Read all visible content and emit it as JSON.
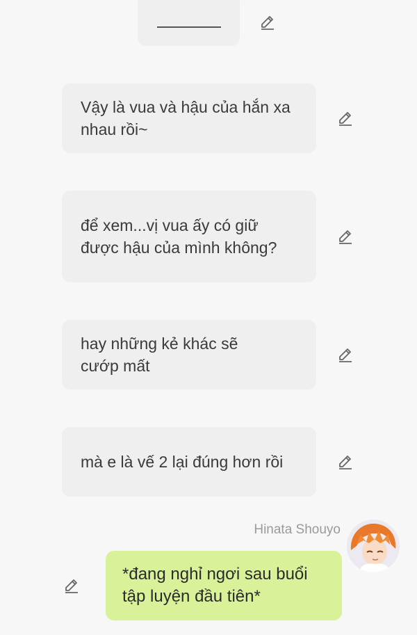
{
  "messages": [
    {
      "text": "Vậy là vua và hậu của hắn xa nhau rồi~"
    },
    {
      "text": "để xem...vị vua ấy có giữ được hậu của mình không?"
    },
    {
      "text": "hay những kẻ khác sẽ cướp mất"
    },
    {
      "text": "mà e là vế 2 lại đúng hơn rồi"
    }
  ],
  "user_message": {
    "sender": "Hinata Shouyo",
    "text": "*đang nghỉ ngơi sau buổi tập luyện đầu tiên*"
  },
  "icons": {
    "edit": "pencil-edit-icon",
    "avatar": "character-avatar"
  },
  "colors": {
    "background": "#f7f7f7",
    "bubble": "#efefef",
    "user_bubble": "#d9f29a",
    "sender_name": "#9a9a9a"
  }
}
